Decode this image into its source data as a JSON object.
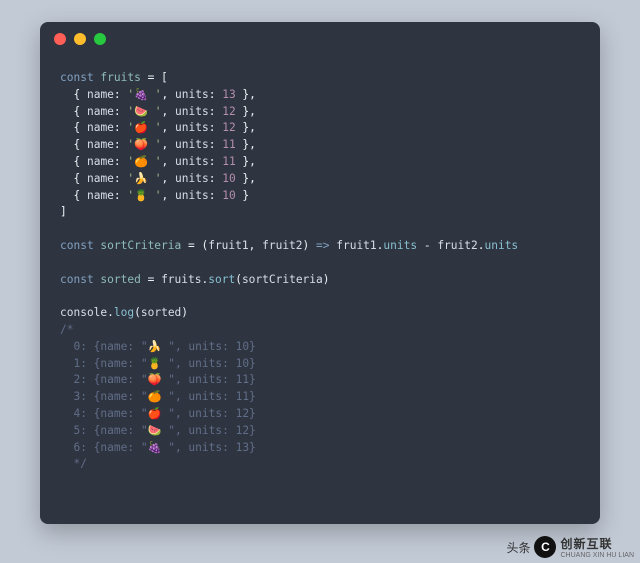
{
  "window": {
    "dots": [
      "#ff5f56",
      "#ffbd2e",
      "#27c93f"
    ]
  },
  "code": {
    "lines": [
      [
        [
          "kw",
          "const"
        ],
        [
          "",
          ""
        ],
        [
          "decl",
          " fruits"
        ],
        [
          "",
          ""
        ],
        [
          "punc",
          " = ["
        ]
      ],
      [
        [
          "",
          "  "
        ],
        [
          "punc",
          "{ "
        ],
        [
          "id",
          "name"
        ],
        [
          "punc",
          ": "
        ],
        [
          "str",
          "'🍇 '"
        ],
        [
          "punc",
          ", "
        ],
        [
          "id",
          "units"
        ],
        [
          "punc",
          ": "
        ],
        [
          "num",
          "13"
        ],
        [
          "punc",
          " },"
        ]
      ],
      [
        [
          "",
          "  "
        ],
        [
          "punc",
          "{ "
        ],
        [
          "id",
          "name"
        ],
        [
          "punc",
          ": "
        ],
        [
          "str",
          "'🍉 '"
        ],
        [
          "punc",
          ", "
        ],
        [
          "id",
          "units"
        ],
        [
          "punc",
          ": "
        ],
        [
          "num",
          "12"
        ],
        [
          "punc",
          " },"
        ]
      ],
      [
        [
          "",
          "  "
        ],
        [
          "punc",
          "{ "
        ],
        [
          "id",
          "name"
        ],
        [
          "punc",
          ": "
        ],
        [
          "str",
          "'🍎 '"
        ],
        [
          "punc",
          ", "
        ],
        [
          "id",
          "units"
        ],
        [
          "punc",
          ": "
        ],
        [
          "num",
          "12"
        ],
        [
          "punc",
          " },"
        ]
      ],
      [
        [
          "",
          "  "
        ],
        [
          "punc",
          "{ "
        ],
        [
          "id",
          "name"
        ],
        [
          "punc",
          ": "
        ],
        [
          "str",
          "'🍑 '"
        ],
        [
          "punc",
          ", "
        ],
        [
          "id",
          "units"
        ],
        [
          "punc",
          ": "
        ],
        [
          "num",
          "11"
        ],
        [
          "punc",
          " },"
        ]
      ],
      [
        [
          "",
          "  "
        ],
        [
          "punc",
          "{ "
        ],
        [
          "id",
          "name"
        ],
        [
          "punc",
          ": "
        ],
        [
          "str",
          "'🍊 '"
        ],
        [
          "punc",
          ", "
        ],
        [
          "id",
          "units"
        ],
        [
          "punc",
          ": "
        ],
        [
          "num",
          "11"
        ],
        [
          "punc",
          " },"
        ]
      ],
      [
        [
          "",
          "  "
        ],
        [
          "punc",
          "{ "
        ],
        [
          "id",
          "name"
        ],
        [
          "punc",
          ": "
        ],
        [
          "str",
          "'🍌 '"
        ],
        [
          "punc",
          ", "
        ],
        [
          "id",
          "units"
        ],
        [
          "punc",
          ": "
        ],
        [
          "num",
          "10"
        ],
        [
          "punc",
          " },"
        ]
      ],
      [
        [
          "",
          "  "
        ],
        [
          "punc",
          "{ "
        ],
        [
          "id",
          "name"
        ],
        [
          "punc",
          ": "
        ],
        [
          "str",
          "'🍍 '"
        ],
        [
          "punc",
          ", "
        ],
        [
          "id",
          "units"
        ],
        [
          "punc",
          ": "
        ],
        [
          "num",
          "10"
        ],
        [
          "punc",
          " }"
        ]
      ],
      [
        [
          "punc",
          "]"
        ]
      ],
      [
        [
          "",
          ""
        ]
      ],
      [
        [
          "kw",
          "const"
        ],
        [
          "decl",
          " sortCriteria"
        ],
        [
          "punc",
          " = ("
        ],
        [
          "id",
          "fruit1"
        ],
        [
          "punc",
          ", "
        ],
        [
          "id",
          "fruit2"
        ],
        [
          "punc",
          ") "
        ],
        [
          "arrow",
          "=>"
        ],
        [
          "id",
          " fruit1"
        ],
        [
          "punc",
          "."
        ],
        [
          "prop",
          "units"
        ],
        [
          "punc",
          " - "
        ],
        [
          "id",
          "fruit2"
        ],
        [
          "punc",
          "."
        ],
        [
          "prop",
          "units"
        ]
      ],
      [
        [
          "",
          ""
        ]
      ],
      [
        [
          "kw",
          "const"
        ],
        [
          "decl",
          " sorted"
        ],
        [
          "punc",
          " = "
        ],
        [
          "id",
          "fruits"
        ],
        [
          "punc",
          "."
        ],
        [
          "prop",
          "sort"
        ],
        [
          "punc",
          "("
        ],
        [
          "id",
          "sortCriteria"
        ],
        [
          "punc",
          ")"
        ]
      ],
      [
        [
          "",
          ""
        ]
      ],
      [
        [
          "id",
          "console"
        ],
        [
          "punc",
          "."
        ],
        [
          "prop",
          "log"
        ],
        [
          "punc",
          "("
        ],
        [
          "id",
          "sorted"
        ],
        [
          "punc",
          ")"
        ]
      ],
      [
        [
          "cmt",
          "/*"
        ]
      ],
      [
        [
          "cmt",
          "  0: {name: \"🍌 \", units: 10}"
        ]
      ],
      [
        [
          "cmt",
          "  1: {name: \"🍍 \", units: 10}"
        ]
      ],
      [
        [
          "cmt",
          "  2: {name: \"🍑 \", units: 11}"
        ]
      ],
      [
        [
          "cmt",
          "  3: {name: \"🍊 \", units: 11}"
        ]
      ],
      [
        [
          "cmt",
          "  4: {name: \"🍎 \", units: 12}"
        ]
      ],
      [
        [
          "cmt",
          "  5: {name: \"🍉 \", units: 12}"
        ]
      ],
      [
        [
          "cmt",
          "  6: {name: \"🍇 \", units: 13}"
        ]
      ],
      [
        [
          "cmt",
          "  */"
        ]
      ]
    ]
  },
  "footer": {
    "left_text": "头条",
    "logo_letter": "C",
    "brand": "创新互联",
    "brand_sub": "CHUANG XIN HU LIAN"
  }
}
